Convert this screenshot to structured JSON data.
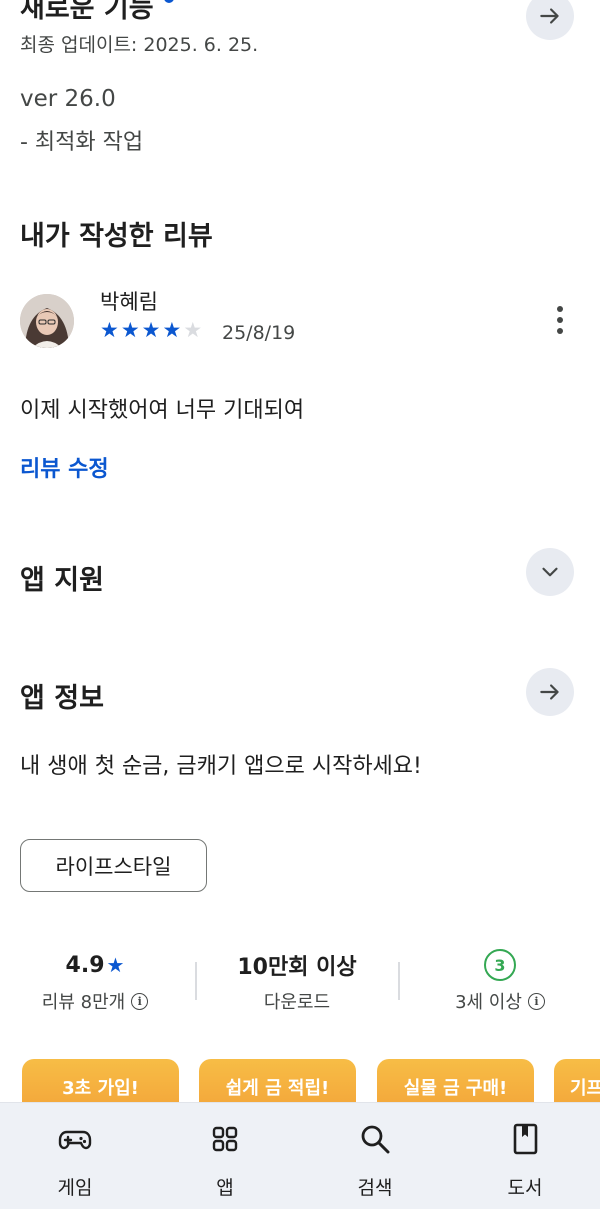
{
  "whats_new": {
    "title": "새로운 기능",
    "updated": "최종 업데이트: 2025. 6. 25.",
    "version": "ver 26.0",
    "notes": "- 최적화 작업"
  },
  "my_review": {
    "section_title": "내가 작성한 리뷰",
    "reviewer": "박혜림",
    "rating": 4,
    "max_rating": 5,
    "date": "25/8/19",
    "text": "이제 시작했어여 너무 기대되여",
    "edit_label": "리뷰 수정"
  },
  "app_support": {
    "title": "앱 지원"
  },
  "app_info": {
    "title": "앱 정보",
    "description": "내 생애 첫 순금, 금캐기 앱으로 시작하세요!",
    "category_chip": "라이프스타일"
  },
  "stats": {
    "rating": "4.9",
    "rating_star": "★",
    "reviews": "리뷰 8만개",
    "downloads": "10만회 이상",
    "downloads_label": "다운로드",
    "age_badge": "3",
    "age_label": "3세 이상"
  },
  "promos": [
    "3초 가입!",
    "쉽게 금 적립!",
    "실물 금 구매!",
    "기프"
  ],
  "bottom_nav": {
    "games": "게임",
    "apps": "앱",
    "search": "검색",
    "books": "도서"
  },
  "colors": {
    "accent": "#0b57d0",
    "promo": "#f3a238",
    "age_badge": "#34a853"
  }
}
